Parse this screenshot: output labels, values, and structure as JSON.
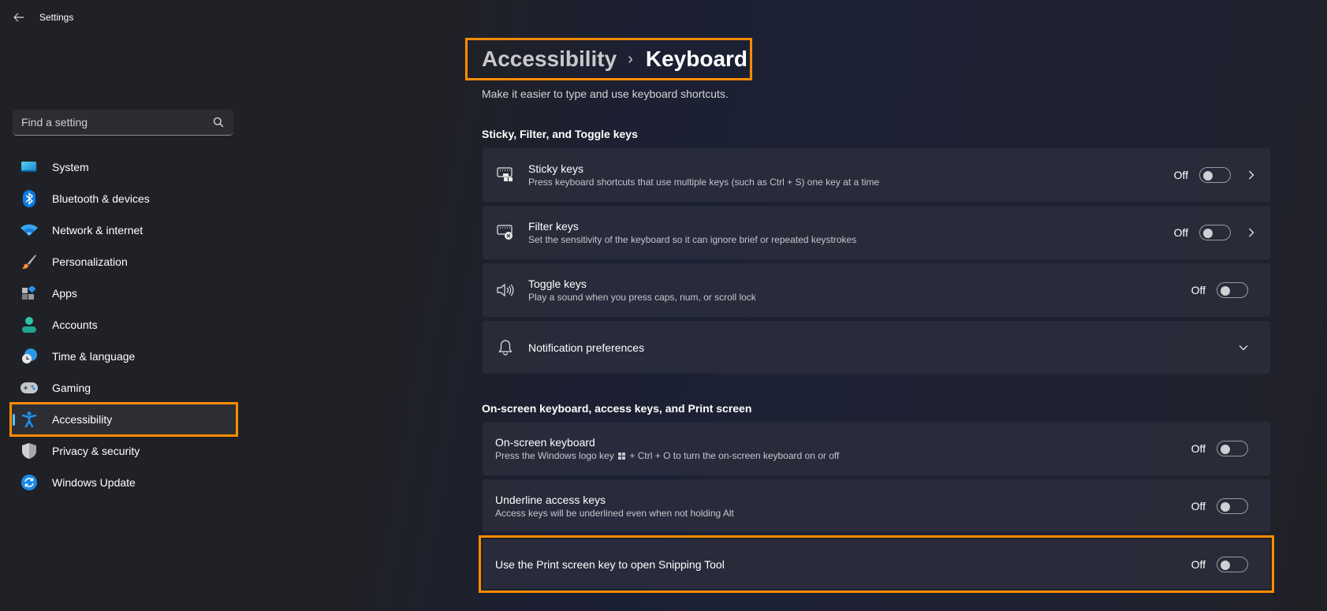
{
  "window": {
    "title": "Settings",
    "back_icon": "arrow-left-icon"
  },
  "search": {
    "placeholder": "Find a setting",
    "value": "",
    "icon": "search-icon"
  },
  "sidebar": {
    "active_index": 8,
    "items": [
      {
        "label": "System",
        "icon": "monitor-icon"
      },
      {
        "label": "Bluetooth & devices",
        "icon": "bluetooth-icon"
      },
      {
        "label": "Network & internet",
        "icon": "wifi-icon"
      },
      {
        "label": "Personalization",
        "icon": "paintbrush-icon"
      },
      {
        "label": "Apps",
        "icon": "apps-icon"
      },
      {
        "label": "Accounts",
        "icon": "person-icon"
      },
      {
        "label": "Time & language",
        "icon": "globe-clock-icon"
      },
      {
        "label": "Gaming",
        "icon": "gamepad-icon"
      },
      {
        "label": "Accessibility",
        "icon": "accessibility-icon"
      },
      {
        "label": "Privacy & security",
        "icon": "shield-icon"
      },
      {
        "label": "Windows Update",
        "icon": "refresh-icon"
      }
    ]
  },
  "header": {
    "breadcrumb_parent": "Accessibility",
    "breadcrumb_separator": "›",
    "breadcrumb_current": "Keyboard",
    "description": "Make it easier to type and use keyboard shortcuts."
  },
  "sections": [
    {
      "title": "Sticky, Filter, and Toggle keys",
      "items": [
        {
          "title": "Sticky keys",
          "subtitle": "Press keyboard shortcuts that use multiple keys (such as Ctrl + S) one key at a time",
          "icon": "sticky-keys-icon",
          "state": "Off",
          "toggle_on": false,
          "has_chevron": true
        },
        {
          "title": "Filter keys",
          "subtitle": "Set the sensitivity of the keyboard so it can ignore brief or repeated keystrokes",
          "icon": "filter-keys-icon",
          "state": "Off",
          "toggle_on": false,
          "has_chevron": true
        },
        {
          "title": "Toggle keys",
          "subtitle": "Play a sound when you press caps, num, or scroll lock",
          "icon": "speaker-icon",
          "state": "Off",
          "toggle_on": false,
          "has_chevron": false
        },
        {
          "title": "Notification preferences",
          "icon": "bell-icon",
          "expandable": true
        }
      ]
    },
    {
      "title": "On-screen keyboard, access keys, and Print screen",
      "items": [
        {
          "title": "On-screen keyboard",
          "subtitle_before": "Press the Windows logo key",
          "subtitle_after": "+ Ctrl + O to turn the on-screen keyboard on or off",
          "state": "Off",
          "toggle_on": false
        },
        {
          "title": "Underline access keys",
          "subtitle": "Access keys will be underlined even when not holding Alt",
          "state": "Off",
          "toggle_on": false
        },
        {
          "title": "Use the Print screen key to open Snipping Tool",
          "state": "Off",
          "toggle_on": false
        }
      ]
    }
  ],
  "colors": {
    "highlight": "#ff8c00",
    "accent": "#4cc2ff"
  }
}
